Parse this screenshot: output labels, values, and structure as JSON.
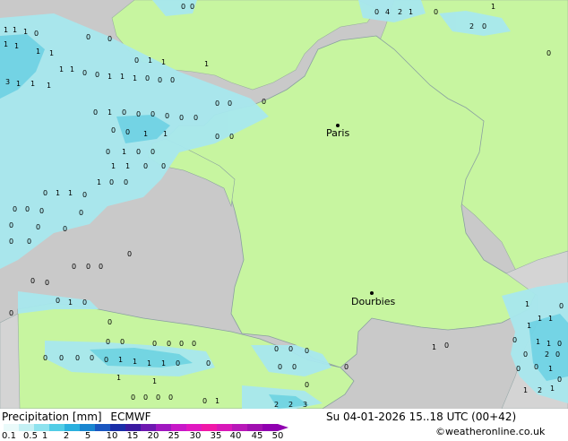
{
  "map": {
    "cities": [
      {
        "name": "Paris"
      },
      {
        "name": "Dourbies"
      }
    ],
    "colors": {
      "sea": "#c9c9c9",
      "land": "#c7f5a0",
      "precip_light": "#a8e8ee",
      "precip_medium": "#6fd4e6",
      "border": "#8aa0a0"
    }
  },
  "footer": {
    "title": "Precipitation [mm]",
    "model": "ECMWF",
    "datetime": "Su 04-01-2026 15..18 UTC (00+42)",
    "credit": "©weatheronline.co.uk",
    "scale_labels": [
      "0.1",
      "0.5",
      "1",
      "2",
      "5",
      "10",
      "15",
      "20",
      "25",
      "30",
      "35",
      "40",
      "45",
      "50"
    ],
    "scale_colors": [
      "#eafafa",
      "#c4f0f4",
      "#8ee2ee",
      "#52cde6",
      "#2ab0de",
      "#1a86d0",
      "#1a56c0",
      "#1a2ea8",
      "#3a1aa0",
      "#6e18b0",
      "#a018c0",
      "#c818c8",
      "#e018c0",
      "#f018a8",
      "#d818b8",
      "#b818b8",
      "#a010b0",
      "#9000b0"
    ]
  }
}
